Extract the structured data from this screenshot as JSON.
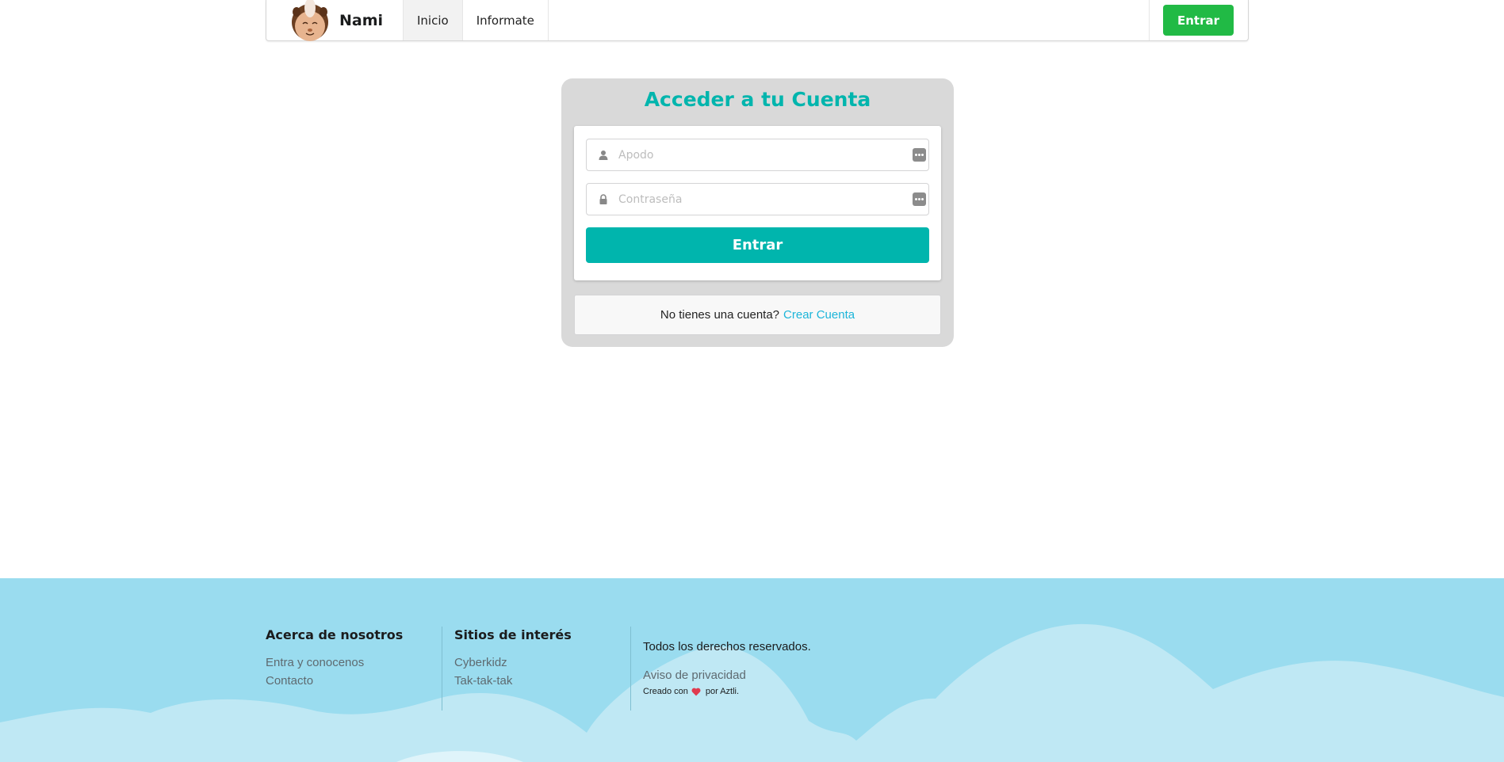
{
  "navbar": {
    "brand_name": "Nami",
    "items": [
      {
        "label": "Inicio",
        "active": true
      },
      {
        "label": "Informate",
        "active": false
      }
    ],
    "login_button": "Entrar",
    "logo_icon": "guinea-pig-logo"
  },
  "login": {
    "title": "Acceder a tu Cuenta",
    "username_placeholder": "Apodo",
    "password_placeholder": "Contraseña",
    "submit_label": "Entrar",
    "signup_prompt": "No tienes una cuenta?",
    "signup_link": "Crear Cuenta"
  },
  "footer": {
    "about": {
      "heading": "Acerca de nosotros",
      "links": [
        "Entra y conocenos",
        "Contacto"
      ]
    },
    "sites": {
      "heading": "Sitios de interés",
      "links": [
        "Cyberkidz",
        "Tak-tak-tak"
      ]
    },
    "rights": "Todos los derechos reservados.",
    "privacy": "Aviso de privacidad",
    "credits_prefix": "Creado con",
    "credits_suffix": "por Aztli."
  },
  "colors": {
    "accent_teal": "#00b5ad",
    "button_green": "#21ba45",
    "link_blue": "#1cb5d9",
    "footer_bg": "#9adcef"
  }
}
